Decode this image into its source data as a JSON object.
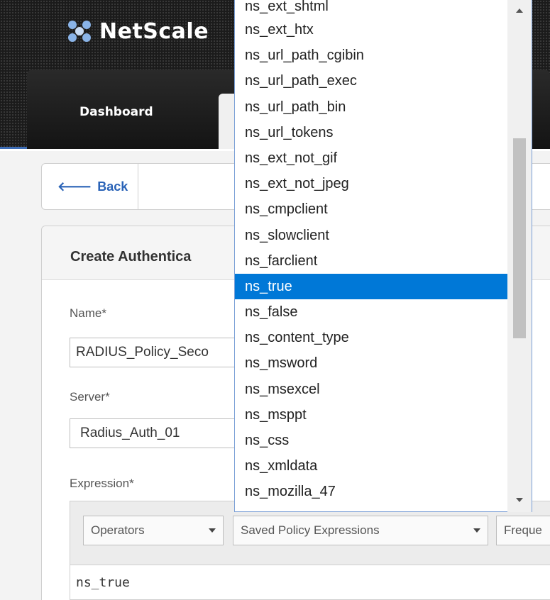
{
  "app": {
    "brand": "NetScale",
    "nav_tabs": [
      {
        "label": "Dashboard"
      }
    ]
  },
  "back_button": {
    "label": "Back"
  },
  "panel": {
    "title": "Create Authentica"
  },
  "form": {
    "name_label": "Name*",
    "name_value": "RADIUS_Policy_Seco",
    "server_label": "Server*",
    "server_value": "Radius_Auth_01",
    "expression_label": "Expression*",
    "expression_value": "ns_true"
  },
  "expression_toolbar": {
    "operators": "Operators",
    "saved_policy_expressions": "Saved Policy Expressions",
    "frequent": "Freque"
  },
  "dropdown": {
    "selected": "ns_true",
    "items": [
      "ns_ext_shtml",
      "ns_ext_htx",
      "ns_url_path_cgibin",
      "ns_url_path_exec",
      "ns_url_path_bin",
      "ns_url_tokens",
      "ns_ext_not_gif",
      "ns_ext_not_jpeg",
      "ns_cmpclient",
      "ns_slowclient",
      "ns_farclient",
      "ns_true",
      "ns_false",
      "ns_content_type",
      "ns_msword",
      "ns_msexcel",
      "ns_msppt",
      "ns_css",
      "ns_xmldata",
      "ns_mozilla_47"
    ]
  },
  "colors": {
    "accent": "#3d6db6",
    "selection": "#0078d7",
    "link": "#2a63b7"
  },
  "icons": {
    "logo": "citrix-logo-icon",
    "back": "arrow-left-icon",
    "caret": "chevron-down-icon"
  }
}
